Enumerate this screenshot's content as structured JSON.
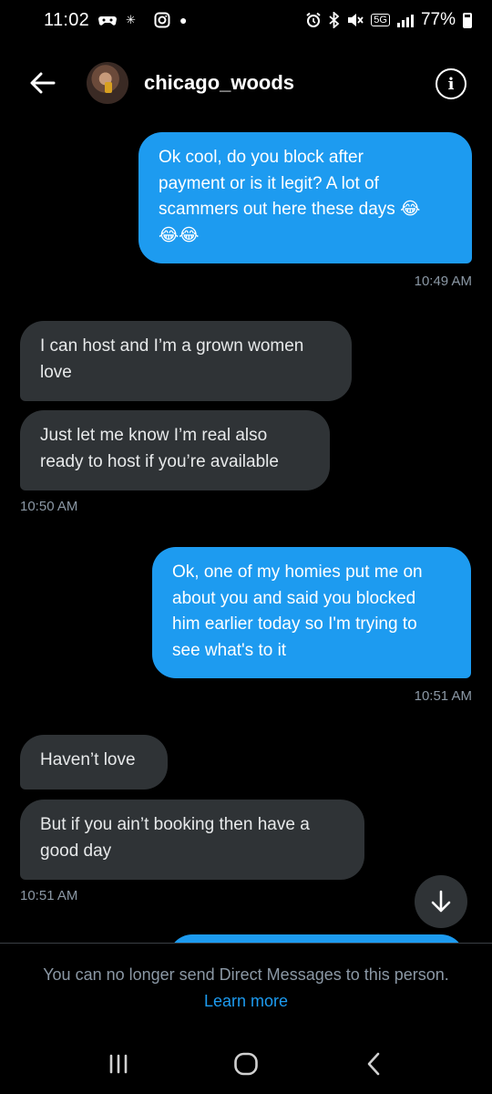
{
  "status_bar": {
    "time": "11:02",
    "battery": "77%",
    "network": "5G"
  },
  "header": {
    "username": "chicago_woods",
    "back_icon": "arrow-left-icon",
    "info_icon": "info-icon"
  },
  "messages": [
    {
      "direction": "out",
      "text_lines": [
        "Ok cool, do you block after",
        "payment or is it legit? A lot of",
        "scammers out here these days 😂",
        "😂😂"
      ]
    },
    {
      "timestamp": "10:49 AM"
    },
    {
      "direction": "in",
      "text_lines": [
        "I can host and I’m a grown women",
        "love"
      ]
    },
    {
      "direction": "in",
      "text_lines": [
        "Just let me know I’m real also",
        "ready to host if you’re available"
      ]
    },
    {
      "timestamp": "10:50 AM"
    },
    {
      "direction": "out",
      "text_lines": [
        "Ok, one of my homies put me on",
        "about you and said you blocked",
        "him earlier today so I'm trying to",
        "see what's to it"
      ]
    },
    {
      "timestamp": "10:51 AM"
    },
    {
      "direction": "in",
      "text_lines": [
        "Haven’t love"
      ]
    },
    {
      "direction": "in",
      "text_lines": [
        "But if you ain’t booking then have a",
        "good day"
      ]
    },
    {
      "timestamp": "10:51 AM"
    }
  ],
  "footer": {
    "notice": "You can no longer send Direct Messages to this person.",
    "link": "Learn more"
  },
  "nav_bar": {
    "recents_icon": "recents-icon",
    "home_icon": "home-icon",
    "back_icon": "back-chevron-icon"
  },
  "colors": {
    "outgoing_bubble": "#1d9bf0",
    "incoming_bubble": "#2f3336",
    "background": "#000000",
    "link": "#1d9bf0"
  }
}
